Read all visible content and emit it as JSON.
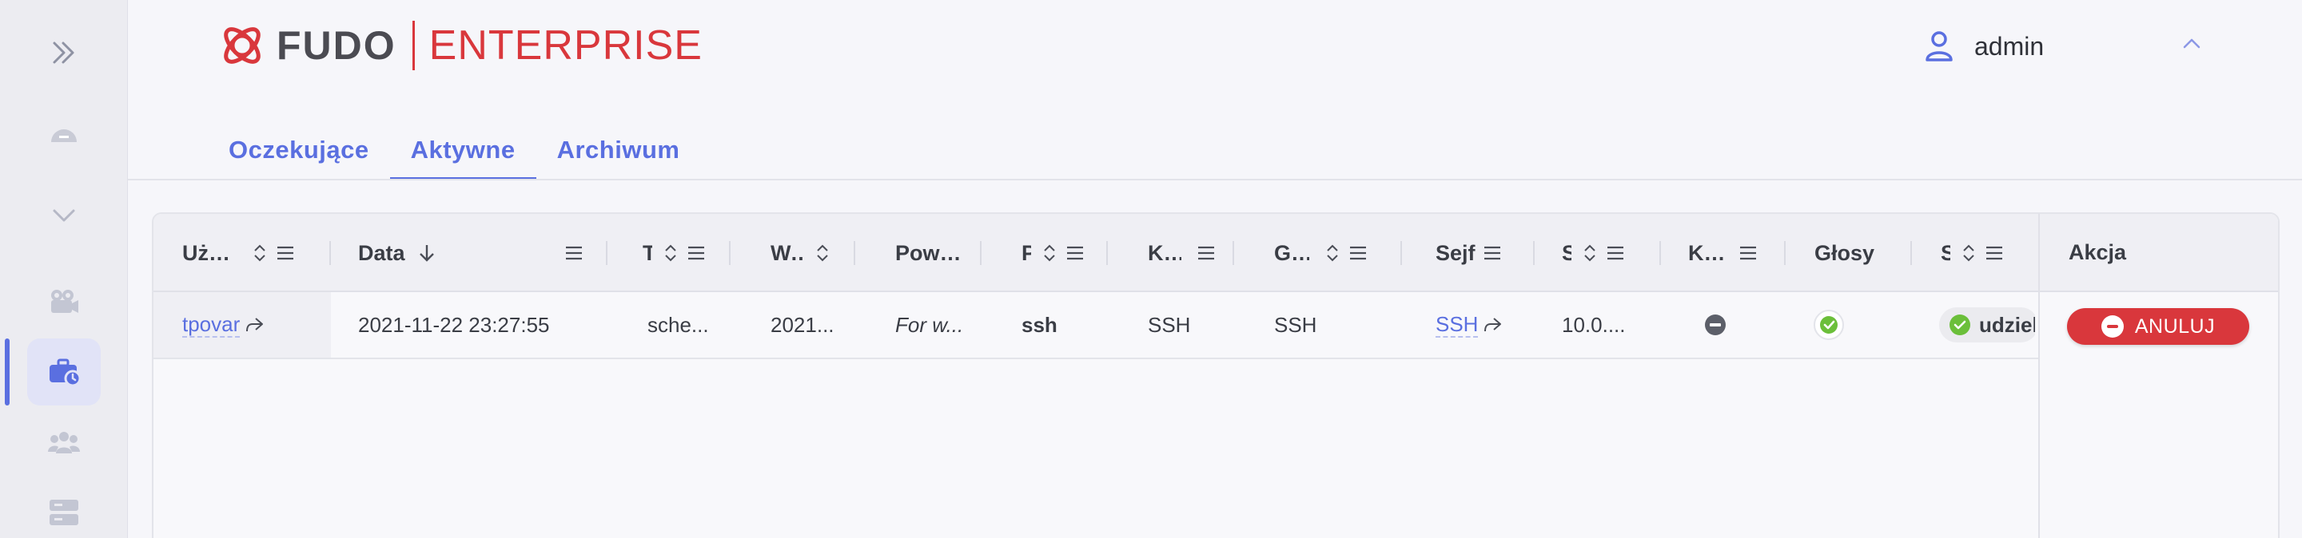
{
  "brand": {
    "fudo": "FUDO",
    "enterprise": "ENTERPRISE",
    "accent": "#d9373c"
  },
  "user": {
    "name": "admin"
  },
  "tabs": [
    {
      "label": "Oczekujące",
      "active": false
    },
    {
      "label": "Aktywne",
      "active": true
    },
    {
      "label": "Archiwum",
      "active": false
    }
  ],
  "sidebar": {
    "items": [
      {
        "icon": "expand-double-chevron-icon"
      },
      {
        "icon": "dashboard-gauge-icon"
      },
      {
        "icon": "chevron-down-icon"
      },
      {
        "icon": "camera-sessions-icon"
      },
      {
        "icon": "briefcase-requests-icon",
        "active": true
      },
      {
        "icon": "users-icon"
      },
      {
        "icon": "servers-icon"
      }
    ]
  },
  "table": {
    "headers": {
      "user": "Użytkownik",
      "date": "Data",
      "type": "Typ",
      "valid": "Ważne do",
      "reason": "Powód",
      "protocol": "Protokół",
      "account": "Konto",
      "server": "Grupa",
      "safe": "Sejf",
      "source": "Serwer",
      "client": "Klient",
      "votes": "Głosy",
      "status": "Status",
      "action": "Akcja"
    },
    "row": {
      "user": "tpovar",
      "date": "2021-11-22 23:27:55",
      "type": "sche...",
      "valid": "2021...",
      "reason": "For w...",
      "protocol": "ssh",
      "account": "SSH",
      "server": "SSH",
      "safe": "SSH",
      "source": "10.0....",
      "status": "udziel",
      "cancel": "ANULUJ"
    }
  },
  "colors": {
    "link": "#5a6fe0",
    "ok": "#6bbf3a",
    "danger": "#d9373c"
  }
}
